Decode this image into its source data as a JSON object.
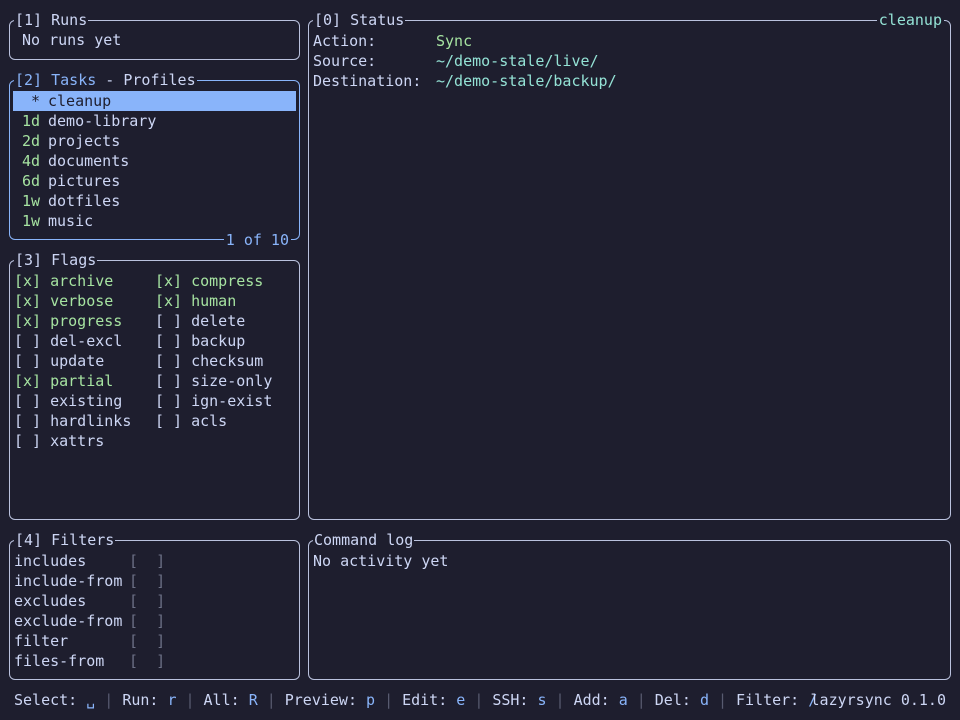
{
  "runs": {
    "title": "[1] Runs",
    "empty_text": "No runs yet"
  },
  "tasks": {
    "title_num": "[2]",
    "title_tasks": "Tasks",
    "title_sep": " - ",
    "title_profiles": "Profiles",
    "position": "1 of 10",
    "items": [
      {
        "age": "*",
        "name": "cleanup",
        "selected": true
      },
      {
        "age": "1d",
        "name": "demo-library"
      },
      {
        "age": "2d",
        "name": "projects"
      },
      {
        "age": "4d",
        "name": "documents"
      },
      {
        "age": "6d",
        "name": "pictures"
      },
      {
        "age": "1w",
        "name": "dotfiles"
      },
      {
        "age": "1w",
        "name": "music"
      }
    ]
  },
  "flags": {
    "title": "[3] Flags",
    "left": [
      {
        "box": "[x]",
        "name": "archive",
        "on": true
      },
      {
        "box": "[x]",
        "name": "verbose",
        "on": true
      },
      {
        "box": "[x]",
        "name": "progress",
        "on": true
      },
      {
        "box": "[ ]",
        "name": "del-excl",
        "on": false
      },
      {
        "box": "[ ]",
        "name": "update",
        "on": false
      },
      {
        "box": "[x]",
        "name": "partial",
        "on": true
      },
      {
        "box": "[ ]",
        "name": "existing",
        "on": false
      },
      {
        "box": "[ ]",
        "name": "hardlinks",
        "on": false
      },
      {
        "box": "[ ]",
        "name": "xattrs",
        "on": false
      }
    ],
    "right": [
      {
        "box": "[x]",
        "name": "compress",
        "on": true
      },
      {
        "box": "[x]",
        "name": "human",
        "on": true
      },
      {
        "box": "[ ]",
        "name": "delete",
        "on": false
      },
      {
        "box": "[ ]",
        "name": "backup",
        "on": false
      },
      {
        "box": "[ ]",
        "name": "checksum",
        "on": false
      },
      {
        "box": "[ ]",
        "name": "size-only",
        "on": false
      },
      {
        "box": "[ ]",
        "name": "ign-exist",
        "on": false
      },
      {
        "box": "[ ]",
        "name": "acls",
        "on": false
      }
    ]
  },
  "filters": {
    "title": "[4] Filters",
    "items": [
      {
        "name": "includes",
        "value": "[  ]"
      },
      {
        "name": "include-from",
        "value": "[  ]"
      },
      {
        "name": "excludes",
        "value": "[  ]"
      },
      {
        "name": "exclude-from",
        "value": "[  ]"
      },
      {
        "name": "filter",
        "value": "[  ]"
      },
      {
        "name": "files-from",
        "value": "[  ]"
      }
    ]
  },
  "status": {
    "title": "[0] Status",
    "profile": "cleanup",
    "action_label": "Action:",
    "action": "Sync",
    "source_label": "Source:",
    "source": "~/demo-stale/live/",
    "destination_label": "Destination:",
    "destination": "~/demo-stale/backup/"
  },
  "command_log": {
    "title": "Command log",
    "empty_text": "No activity yet"
  },
  "statusbar": {
    "items": [
      {
        "label": "Select:",
        "key": "␣"
      },
      {
        "label": "Run:",
        "key": "r"
      },
      {
        "label": "All:",
        "key": "R"
      },
      {
        "label": "Preview:",
        "key": "p"
      },
      {
        "label": "Edit:",
        "key": "e"
      },
      {
        "label": "SSH:",
        "key": "s"
      },
      {
        "label": "Add:",
        "key": "a"
      },
      {
        "label": "Del:",
        "key": "d"
      },
      {
        "label": "Filter:",
        "key": "/"
      }
    ],
    "version": "lazyrsync 0.1.0"
  },
  "colors": {
    "background": "#1e1e2e",
    "text": "#cdd6f4",
    "accent": "#89b4fa",
    "enabled": "#a6e3a1",
    "value": "#94e2d5",
    "border": "#bac2de"
  }
}
